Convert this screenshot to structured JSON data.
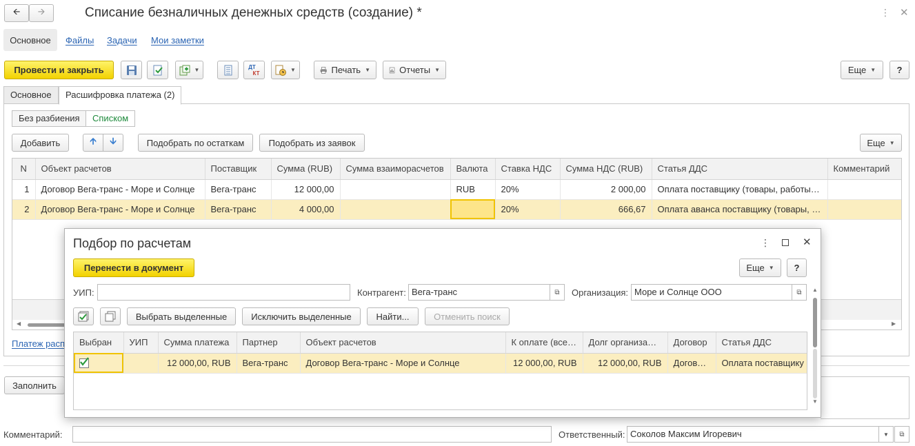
{
  "window": {
    "title": "Списание безналичных денежных средств (создание) *"
  },
  "nav_tabs": [
    "Основное",
    "Файлы",
    "Задачи",
    "Мои заметки"
  ],
  "toolbar": {
    "post_close": "Провести и закрыть",
    "print": "Печать",
    "reports": "Отчеты",
    "more": "Еще",
    "help": "?",
    "dtkt_top": "ДТ",
    "dtkt_bottom": "КТ"
  },
  "form_tabs": [
    "Основное",
    "Расшифровка платежа (2)"
  ],
  "split_toggle": [
    "Без разбиения",
    "Списком"
  ],
  "table_toolbar": {
    "add": "Добавить",
    "pick_balances": "Подобрать по остаткам",
    "pick_requests": "Подобрать из заявок",
    "more": "Еще"
  },
  "payment_table": {
    "columns": [
      "N",
      "Объект расчетов",
      "Поставщик",
      "Сумма (RUB)",
      "Сумма взаиморасчетов",
      "Валюта",
      "Ставка НДС",
      "Сумма НДС (RUB)",
      "Статья ДДС",
      "Комментарий"
    ],
    "rows": [
      [
        "1",
        "Договор Вега-транс -  Море и Солнце",
        "Вега-транс",
        "12 000,00",
        "",
        "RUB",
        "20%",
        "2 000,00",
        "Оплата поставщику (товары, работы,…",
        ""
      ],
      [
        "2",
        "Договор Вега-транс -  Море и Солнце",
        "Вега-транс",
        "4 000,00",
        "",
        "",
        "20%",
        "666,67",
        "Оплата аванса поставщику (товары, …",
        ""
      ]
    ]
  },
  "payment_link": "Платеж расп",
  "fill_button": "Заполнить",
  "footer": {
    "comment_label": "Комментарий:",
    "comment_value": "",
    "responsible_label": "Ответственный:",
    "responsible_value": "Соколов Максим Игоревич"
  },
  "dialog": {
    "title": "Подбор по расчетам",
    "transfer": "Перенести в документ",
    "more": "Еще",
    "help": "?",
    "uip_label": "УИП:",
    "uip_value": "",
    "counterparty_label": "Контрагент:",
    "counterparty_value": "Вега-транс",
    "org_label": "Организация:",
    "org_value": "Море и Солнце ООО",
    "select_selected": "Выбрать выделенные",
    "exclude_selected": "Исключить выделенные",
    "find": "Найти...",
    "cancel_search": "Отменить поиск",
    "table": {
      "columns": [
        "Выбран",
        "УИП",
        "Сумма платежа",
        "Партнер",
        "Объект расчетов",
        "К оплате (всего)",
        "Долг организации",
        "Договор",
        "Статья ДДС"
      ],
      "rows": [
        [
          "",
          "",
          "12 000,00, RUB",
          "Вега-транс",
          "Договор Вега-транс -  Море и Солнце",
          "12 000,00, RUB",
          "12 000,00, RUB",
          "Договор…",
          "Оплата поставщику"
        ]
      ]
    }
  },
  "colors": {
    "accent_yellow": "#f2d200",
    "selected_row": "#fbeec0",
    "link": "#2a64b3",
    "toggle_active": "#1e8a3c"
  }
}
